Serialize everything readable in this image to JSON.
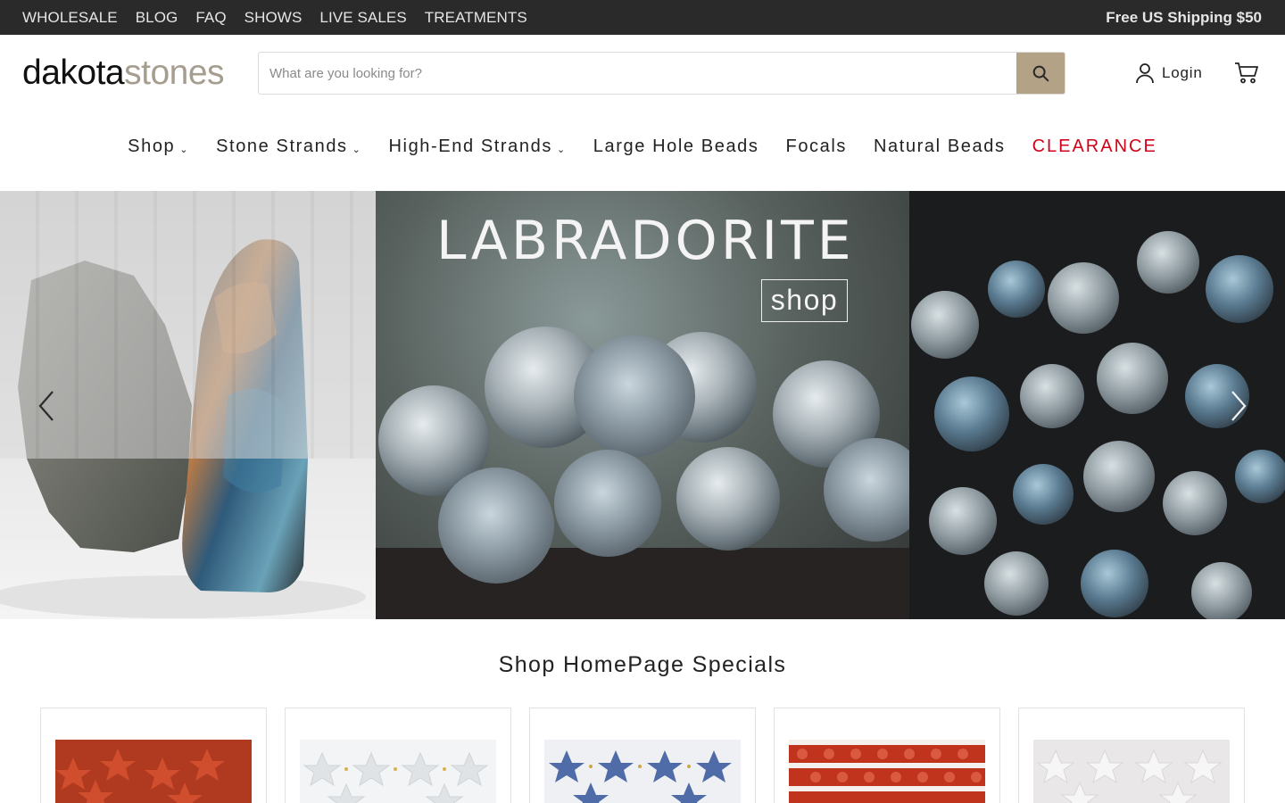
{
  "topbar": {
    "links": [
      "WHOLESALE",
      "BLOG",
      "FAQ",
      "SHOWS",
      "LIVE SALES",
      "TREATMENTS"
    ],
    "promo": "Free US Shipping $50"
  },
  "header": {
    "logo_part1": "dakota",
    "logo_part2": "stones",
    "search_placeholder": "What are you looking for?",
    "login_label": "Login"
  },
  "nav": {
    "items": [
      {
        "label": "Shop",
        "dropdown": true
      },
      {
        "label": "Stone Strands",
        "dropdown": true
      },
      {
        "label": "High-End Strands",
        "dropdown": true
      },
      {
        "label": "Large Hole Beads",
        "dropdown": false
      },
      {
        "label": "Focals",
        "dropdown": false
      },
      {
        "label": "Natural Beads",
        "dropdown": false
      },
      {
        "label": "CLEARANCE",
        "dropdown": false,
        "highlight": "#d0021b"
      }
    ]
  },
  "hero": {
    "title": "LABRADORITE",
    "button": "shop",
    "prev_icon": "chevron-left-icon",
    "next_icon": "chevron-right-icon"
  },
  "specials": {
    "heading": "Shop HomePage Specials",
    "products": [
      {
        "name": "red star beads",
        "color": "#b83a1f"
      },
      {
        "name": "clear quartz star beads",
        "color": "#e4e6e8"
      },
      {
        "name": "blue sodalite star beads",
        "color": "#4f6ca8"
      },
      {
        "name": "red carnelian star beads",
        "color": "#c0341e"
      },
      {
        "name": "white star beads",
        "color": "#ece9e9"
      }
    ]
  },
  "colors": {
    "topbar_bg": "#2a2a2a",
    "accent": "#b4a286",
    "clearance": "#d0021b"
  }
}
